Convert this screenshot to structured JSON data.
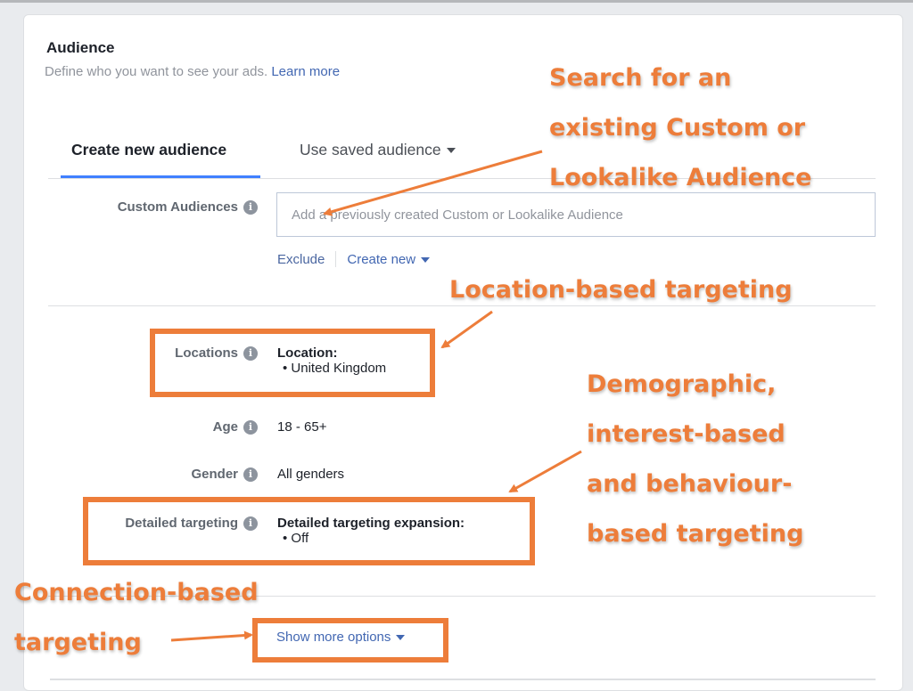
{
  "section": {
    "title": "Audience",
    "subtitle": "Define who you want to see your ads.",
    "learn_more": "Learn more"
  },
  "tabs": [
    {
      "label": "Create new audience",
      "active": true
    },
    {
      "label": "Use saved audience",
      "active": false
    }
  ],
  "custom_audiences": {
    "label": "Custom Audiences",
    "placeholder": "Add a previously created Custom or Lookalike Audience",
    "value": "",
    "exclude": "Exclude",
    "create_new": "Create new"
  },
  "locations": {
    "label": "Locations",
    "heading": "Location:",
    "items": [
      "United Kingdom"
    ]
  },
  "age": {
    "label": "Age",
    "value": "18 - 65+"
  },
  "gender": {
    "label": "Gender",
    "value": "All genders"
  },
  "detailed_targeting": {
    "label": "Detailed targeting",
    "heading": "Detailed targeting expansion:",
    "items": [
      "Off"
    ]
  },
  "show_more": "Show more options",
  "icons": {
    "info": "i"
  },
  "colors": {
    "annotation": "#ed7d3a",
    "link": "#4267b2",
    "tab_underline": "#4080ff"
  },
  "annotations": {
    "custom": [
      "Search for an",
      "existing Custom or",
      "Lookalike Audience"
    ],
    "location": "Location-based targeting",
    "detailed": [
      "Demographic,",
      "interest-based",
      "and behaviour-",
      "based targeting"
    ],
    "connection": [
      "Connection-based",
      "targeting"
    ]
  }
}
